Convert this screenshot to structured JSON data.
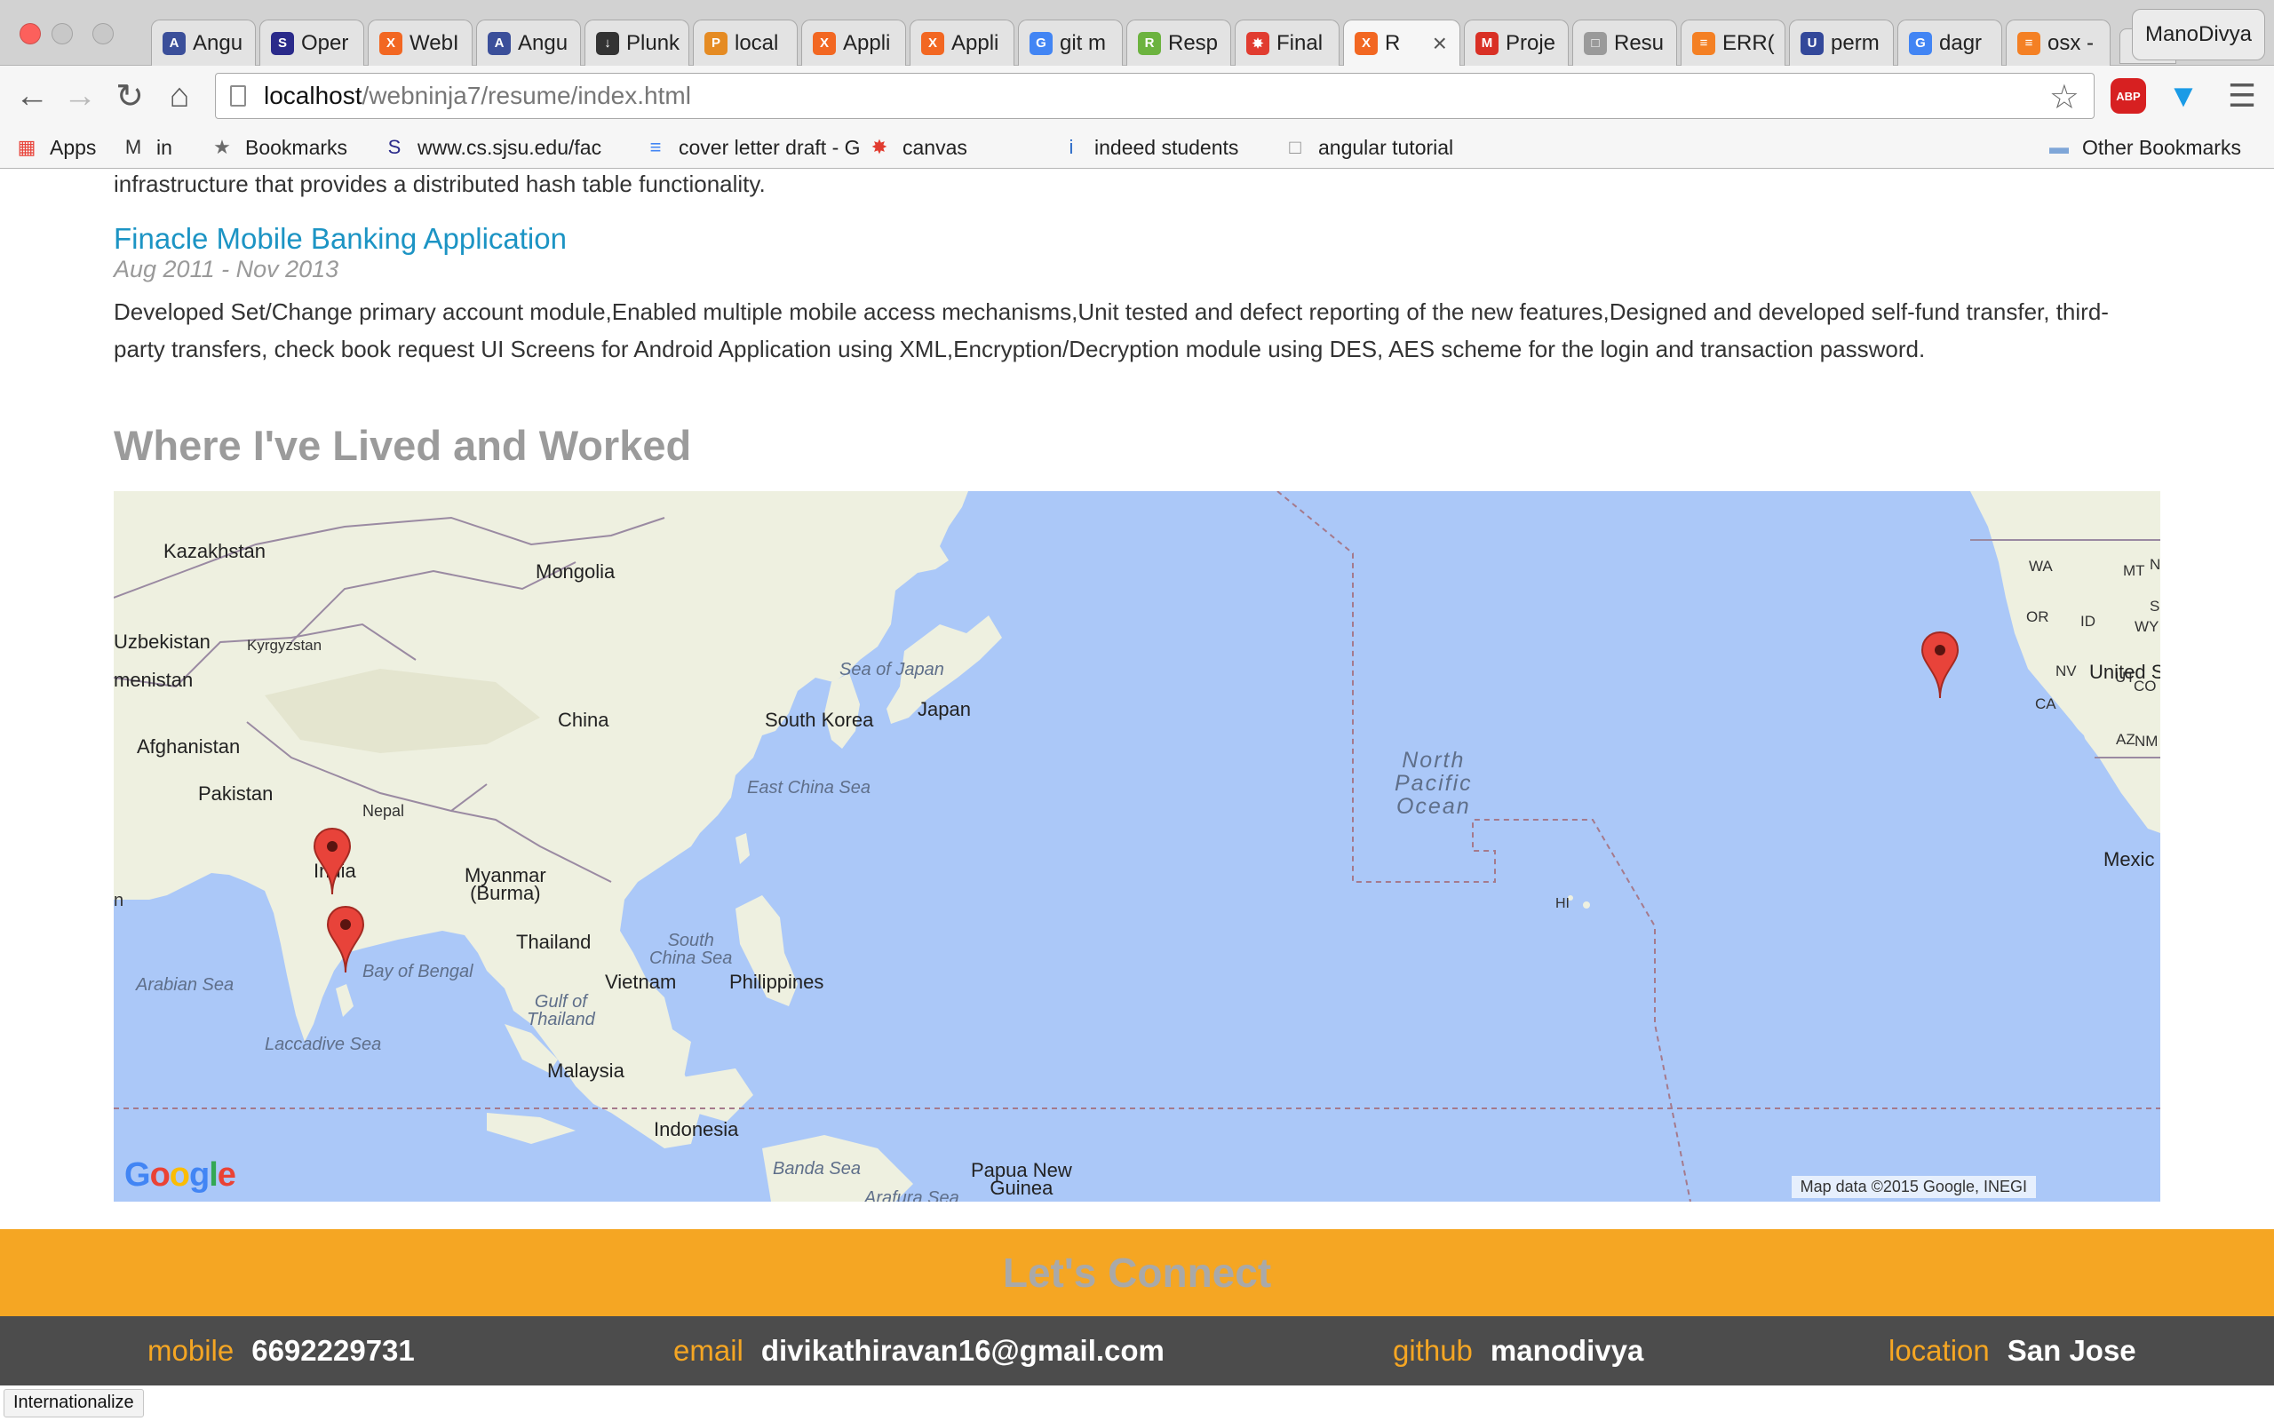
{
  "browser": {
    "profile_name": "ManoDivya",
    "tabs": [
      {
        "title": "Angu",
        "icon": "angular-shield-icon",
        "color": "#3b4f9a"
      },
      {
        "title": "Oper",
        "icon": "sjsu-logo-icon",
        "color": "#2a2a8a"
      },
      {
        "title": "WebI",
        "icon": "xampp-icon",
        "color": "#f26722"
      },
      {
        "title": "Angu",
        "icon": "angular-shield-icon",
        "color": "#3b4f9a"
      },
      {
        "title": "Plunk",
        "icon": "download-icon",
        "color": "#333333"
      },
      {
        "title": "local",
        "icon": "phpmyadmin-icon",
        "color": "#e58b23"
      },
      {
        "title": "Appli",
        "icon": "xampp-icon",
        "color": "#f26722"
      },
      {
        "title": "Appli",
        "icon": "xampp-icon",
        "color": "#f26722"
      },
      {
        "title": "git m",
        "icon": "google-g-icon",
        "color": "#4285f4"
      },
      {
        "title": "Resp",
        "icon": "responsive-icon",
        "color": "#6cb33f"
      },
      {
        "title": "Final",
        "icon": "canvas-icon",
        "color": "#e13c30"
      },
      {
        "title": "R",
        "icon": "xampp-icon",
        "color": "#f26722",
        "active": true
      },
      {
        "title": "Proje",
        "icon": "gmail-icon",
        "color": "#d93025"
      },
      {
        "title": "Resu",
        "icon": "document-icon",
        "color": "#9a9a9a"
      },
      {
        "title": "ERR(",
        "icon": "stackoverflow-icon",
        "color": "#f48024"
      },
      {
        "title": "perm",
        "icon": "ul-logo-icon",
        "color": "#33489a"
      },
      {
        "title": "dagr",
        "icon": "google-g-icon",
        "color": "#4285f4"
      },
      {
        "title": "osx -",
        "icon": "stackoverflow-icon",
        "color": "#f48024"
      }
    ],
    "url": {
      "host": "localhost",
      "path": "/webninja7/resume/index.html"
    },
    "bookmarks": [
      {
        "label": "Apps",
        "icon": "apps-grid-icon"
      },
      {
        "label": "in",
        "icon": "mcs-icon"
      },
      {
        "label": "Bookmarks",
        "icon": "star-icon"
      },
      {
        "label": "www.cs.sjsu.edu/fac",
        "icon": "sjsu-logo-icon"
      },
      {
        "label": "cover letter draft - G",
        "icon": "google-docs-icon"
      },
      {
        "label": "canvas",
        "icon": "canvas-icon"
      },
      {
        "label": "indeed students",
        "icon": "info-icon"
      },
      {
        "label": "angular tutorial",
        "icon": "document-icon"
      },
      {
        "label": "Other Bookmarks",
        "icon": "folder-icon"
      }
    ]
  },
  "resume": {
    "previous_tail": "infrastructure that provides a distributed hash table functionality.",
    "project": {
      "title": "Finacle Mobile Banking Application",
      "dates": "Aug 2011 - Nov 2013",
      "description": "Developed Set/Change primary account module,Enabled multiple mobile access mechanisms,Unit tested and defect reporting of the new features,Designed and developed self-fund transfer, third-party transfers, check book request UI Screens for Android Application using XML,Encryption/Decryption module using DES, AES scheme for the login and transaction password."
    },
    "map_section": {
      "heading": "Where I've Lived and Worked",
      "logo": "Google",
      "credit": "Map data ©2015 Google, INEGI",
      "labels": {
        "kazakhstan": "Kazakhstan",
        "mongolia": "Mongolia",
        "uzbekistan": "Uzbekistan",
        "kyrgyzstan": "Kyrgyzstan",
        "turkmenistan": "menistan",
        "china": "China",
        "south_korea": "South Korea",
        "japan": "Japan",
        "sea_of_japan": "Sea of Japan",
        "east_china_sea": "East China Sea",
        "afghanistan": "Afghanistan",
        "pakistan": "Pakistan",
        "nepal": "Nepal",
        "india": "India",
        "myanmar": "Myanmar\n(Burma)",
        "thailand": "Thailand",
        "vietnam": "Vietnam",
        "philippines": "Philippines",
        "south_china_sea": "South\nChina Sea",
        "gulf_of_thailand": "Gulf of\nThailand",
        "bay_of_bengal": "Bay of Bengal",
        "arabian_sea": "Arabian Sea",
        "laccadive_sea": "Laccadive Sea",
        "malaysia": "Malaysia",
        "indonesia": "Indonesia",
        "banda_sea": "Banda Sea",
        "arafura_sea": "Arafura Sea",
        "papua_new_guinea": "Papua New\nGuinea",
        "north_pacific_ocean": "North\nPacific\nOcean",
        "hi": "HI",
        "wa": "WA",
        "or": "OR",
        "id": "ID",
        "mt": "MT",
        "wy": "WY",
        "nv": "NV",
        "ut": "UT",
        "ca": "CA",
        "co": "CO",
        "az": "AZ",
        "nm": "NM",
        "united_states": "United S",
        "mexico": "Mexic",
        "edge_n": "n",
        "edge_ne": "N",
        "edge_s": "S"
      },
      "markers": [
        {
          "place": "central India",
          "icon": "map-marker-icon"
        },
        {
          "place": "south India",
          "icon": "map-marker-icon"
        },
        {
          "place": "San Jose, CA",
          "icon": "map-marker-icon"
        }
      ]
    },
    "connect": {
      "heading": "Let's Connect",
      "items": [
        {
          "label": "mobile",
          "value": "6692229731"
        },
        {
          "label": "email",
          "value": "divikathiravan16@gmail.com"
        },
        {
          "label": "github",
          "value": "manodivya"
        },
        {
          "label": "location",
          "value": "San Jose"
        }
      ]
    },
    "status_chip": "Internationalize"
  },
  "colors": {
    "accent": "#f5a623",
    "link": "#1c94c4",
    "contact_bar": "#4c4c4c",
    "water": "#abc8f8",
    "land": "#eef0e0",
    "marker": "#e8433a"
  }
}
